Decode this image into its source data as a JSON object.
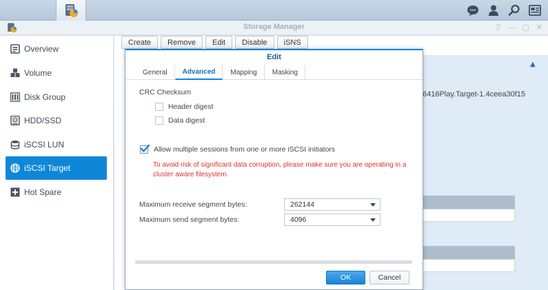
{
  "taskbar": {
    "main_menu_icon": "grid-icon",
    "app_icon": "storage-manager-icon",
    "right_icons": [
      "chat-icon",
      "user-icon",
      "search-icon",
      "widgets-icon"
    ]
  },
  "window": {
    "title": "Storage Manager",
    "controls": [
      "pin",
      "minimize",
      "maximize",
      "close"
    ],
    "control_glyphs": [
      "⍰",
      "—",
      "▢",
      "✕"
    ]
  },
  "sidebar": {
    "items": [
      {
        "label": "Overview",
        "icon": "overview-icon",
        "active": false
      },
      {
        "label": "Volume",
        "icon": "volume-icon",
        "active": false
      },
      {
        "label": "Disk Group",
        "icon": "disk-group-icon",
        "active": false
      },
      {
        "label": "HDD/SSD",
        "icon": "hdd-icon",
        "active": false
      },
      {
        "label": "iSCSI LUN",
        "icon": "database-icon",
        "active": false
      },
      {
        "label": "iSCSI Target",
        "icon": "globe-icon",
        "active": true
      },
      {
        "label": "Hot Spare",
        "icon": "plus-box-icon",
        "active": false
      }
    ]
  },
  "toolbar": {
    "create": "Create",
    "remove": "Remove",
    "edit": "Edit",
    "disable": "Disable",
    "isns": "iSNS"
  },
  "background": {
    "target_iqn_fragment": "6416Play.Target-1.4ceea30f15"
  },
  "dialog": {
    "title": "Edit",
    "tabs": [
      "General",
      "Advanced",
      "Mapping",
      "Masking"
    ],
    "active_tab": "Advanced",
    "crc_heading": "CRC Checksum",
    "header_digest": {
      "label": "Header digest",
      "checked": false
    },
    "data_digest": {
      "label": "Data digest",
      "checked": false
    },
    "multi_session": {
      "label": "Allow multiple sessions from one or more iSCSI initiators",
      "checked": true
    },
    "warning": "To avoid risk of significant data corruption, please make sure you are operating in a cluster aware filesystem.",
    "max_receive": {
      "label": "Maximum receive segment bytes:",
      "value": "262144"
    },
    "max_send": {
      "label": "Maximum send segment bytes:",
      "value": "4096"
    },
    "ok_label": "OK",
    "cancel_label": "Cancel",
    "accent_color": "#0f87d9",
    "warning_color": "#e0302f"
  }
}
